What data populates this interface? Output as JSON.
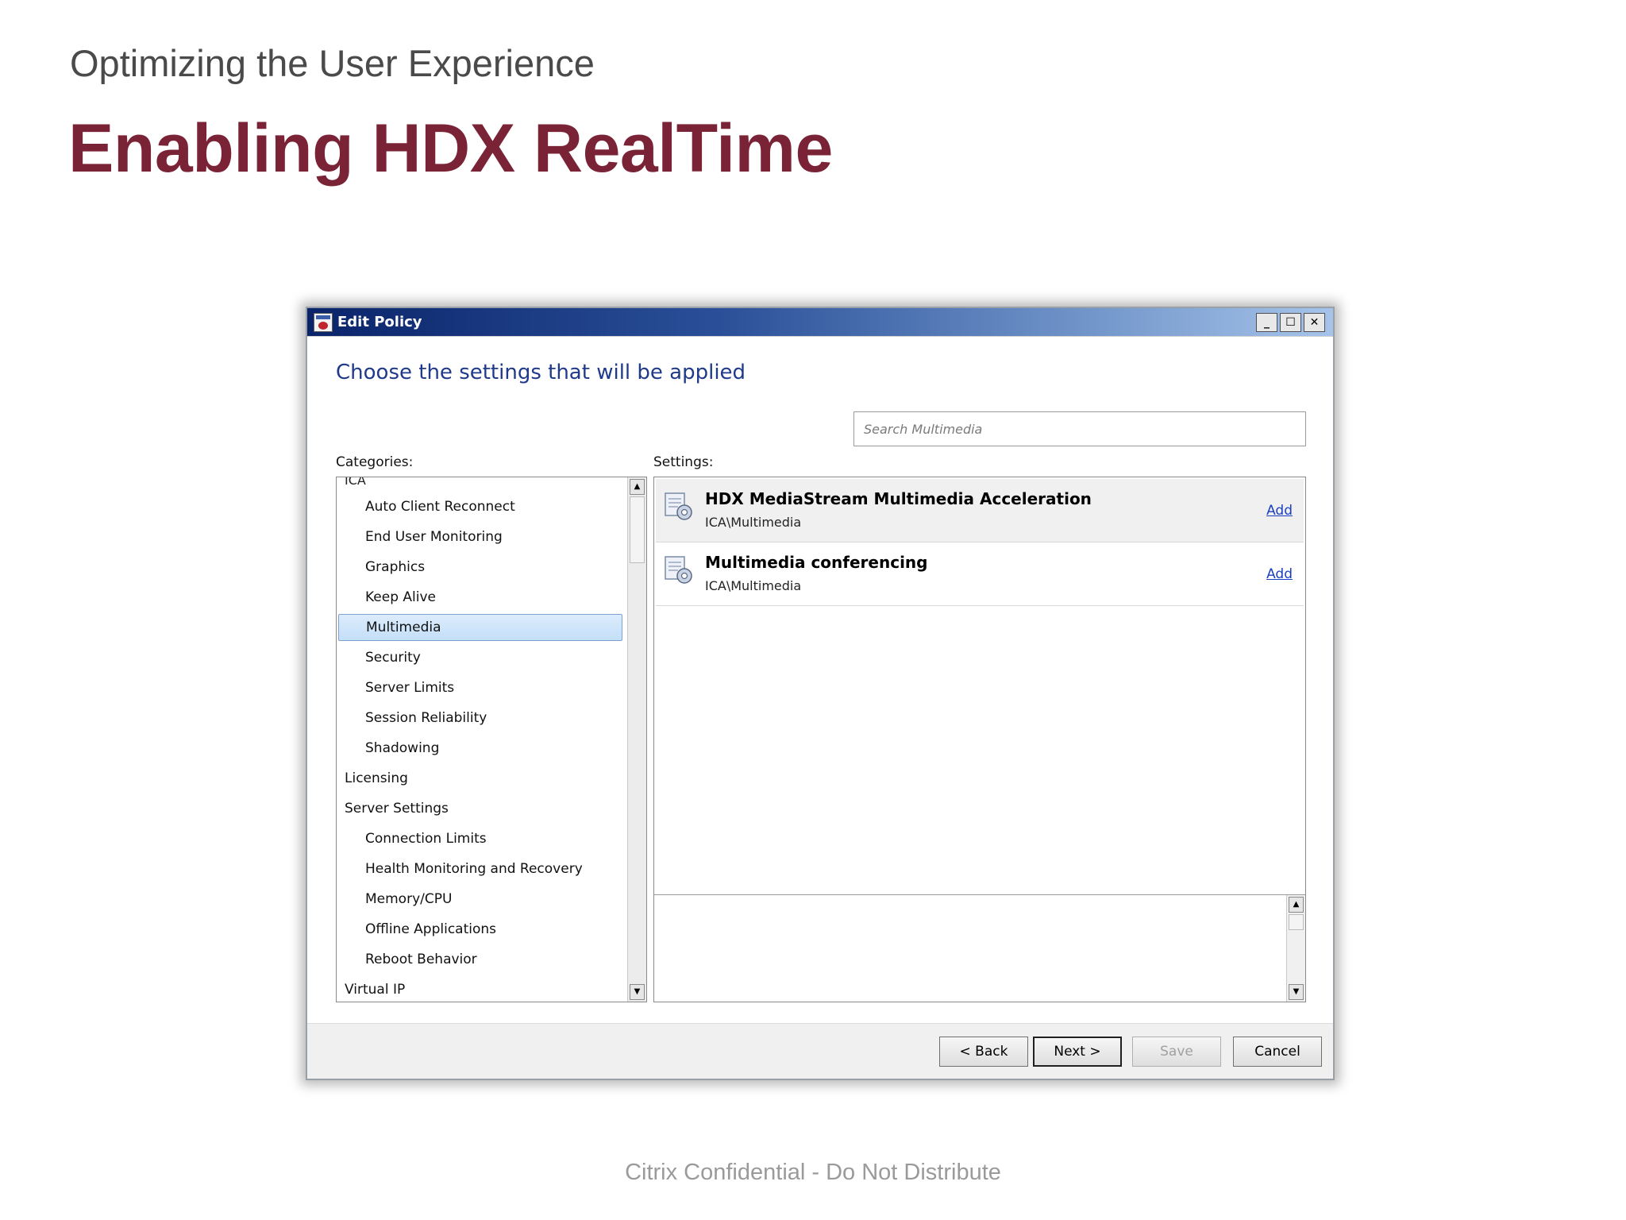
{
  "slide": {
    "subtitle": "Optimizing the User Experience",
    "title": "Enabling HDX RealTime",
    "footer": "Citrix Confidential - Do Not Distribute"
  },
  "window": {
    "title": "Edit Policy",
    "controls": {
      "minimize": "_",
      "maximize": "☐",
      "close": "✕"
    },
    "heading": "Choose the settings that will be applied",
    "search_placeholder": "Search Multimedia",
    "categories_label": "Categories:",
    "settings_label": "Settings:",
    "categories_partial_top": "ICA",
    "categories": [
      {
        "label": "Auto Client Reconnect",
        "level": 1
      },
      {
        "label": "End User Monitoring",
        "level": 1
      },
      {
        "label": "Graphics",
        "level": 1
      },
      {
        "label": "Keep Alive",
        "level": 1
      },
      {
        "label": "Multimedia",
        "level": 1,
        "selected": true
      },
      {
        "label": "Security",
        "level": 1
      },
      {
        "label": "Server Limits",
        "level": 1
      },
      {
        "label": "Session Reliability",
        "level": 1
      },
      {
        "label": "Shadowing",
        "level": 1
      },
      {
        "label": "Licensing",
        "level": 0
      },
      {
        "label": "Server Settings",
        "level": 0
      },
      {
        "label": "Connection Limits",
        "level": 1
      },
      {
        "label": "Health Monitoring and Recovery",
        "level": 1
      },
      {
        "label": "Memory/CPU",
        "level": 1
      },
      {
        "label": "Offline Applications",
        "level": 1
      },
      {
        "label": "Reboot Behavior",
        "level": 1
      },
      {
        "label": "Virtual IP",
        "level": 0
      }
    ],
    "settings": [
      {
        "name": "HDX MediaStream Multimedia Acceleration",
        "path": "ICA\\Multimedia",
        "action": "Add"
      },
      {
        "name": "Multimedia conferencing",
        "path": "ICA\\Multimedia",
        "action": "Add"
      }
    ],
    "buttons": {
      "back": "< Back",
      "next": "Next >",
      "save": "Save",
      "cancel": "Cancel"
    },
    "colors": {
      "heading": "#1f3a8a",
      "link": "#1a3fc0",
      "selection": "#c4dff8",
      "title_accent": "#7b2336"
    },
    "icons": {
      "app": "policy-app-icon",
      "setting": "setting-gear-icon"
    }
  }
}
